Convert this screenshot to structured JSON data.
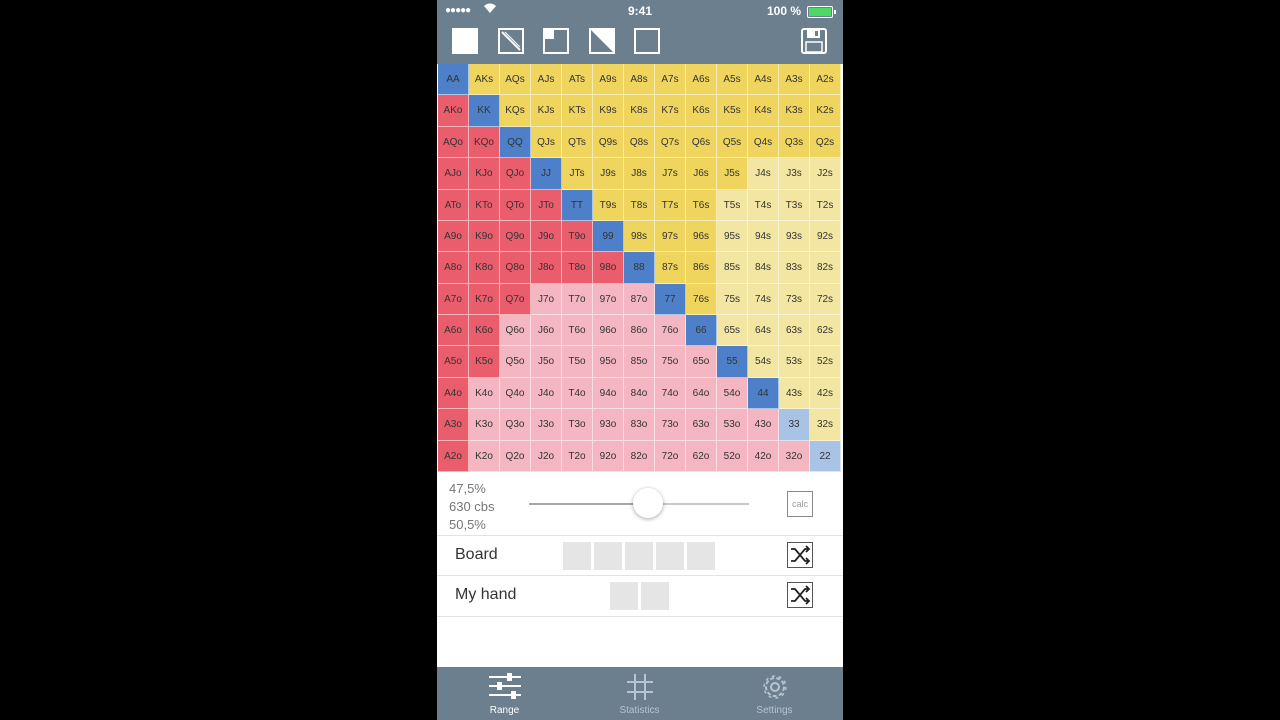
{
  "status_bar": {
    "signal": "●●●●●",
    "time": "9:41",
    "battery": "100 %"
  },
  "colors": {
    "pair": "#4d80c8",
    "pair_light": "#a9c3e6",
    "suited": "#efd45e",
    "suited_light": "#f3e6a2",
    "offsuit": "#ea5d6c",
    "offsuit_light": "#f4b6c0",
    "toolbar": "#6b7f8f"
  },
  "ranks": [
    "A",
    "K",
    "Q",
    "J",
    "T",
    "9",
    "8",
    "7",
    "6",
    "5",
    "4",
    "3",
    "2"
  ],
  "range": {
    "selected_pairs": [
      "AA",
      "KK",
      "QQ",
      "JJ",
      "TT",
      "99",
      "88",
      "77",
      "66",
      "55",
      "44"
    ],
    "selected_offsuit": [
      "AKo",
      "AQo",
      "AJo",
      "ATo",
      "A9o",
      "A8o",
      "A7o",
      "A6o",
      "A5o",
      "A4o",
      "A3o",
      "A2o",
      "KQo",
      "KJo",
      "KTo",
      "K9o",
      "K8o",
      "K7o",
      "K6o",
      "K5o",
      "QJo",
      "QTo",
      "Q9o",
      "Q8o",
      "Q7o",
      "JTo",
      "J9o",
      "J8o",
      "T9o",
      "T8o",
      "98o"
    ],
    "selected_suited": [
      "AKs",
      "AQs",
      "AJs",
      "ATs",
      "A9s",
      "A8s",
      "A7s",
      "A6s",
      "A5s",
      "A4s",
      "A3s",
      "A2s",
      "KQs",
      "KJs",
      "KTs",
      "K9s",
      "K8s",
      "K7s",
      "K6s",
      "K5s",
      "K4s",
      "K3s",
      "K2s",
      "QJs",
      "QTs",
      "Q9s",
      "Q8s",
      "Q7s",
      "Q6s",
      "Q5s",
      "Q4s",
      "Q3s",
      "Q2s",
      "JTs",
      "J9s",
      "J8s",
      "J7s",
      "J6s",
      "J5s",
      "T9s",
      "T8s",
      "T7s",
      "T6s",
      "98s",
      "97s",
      "96s",
      "87s",
      "86s",
      "76s"
    ]
  },
  "stats": {
    "line1": "47,5%",
    "line2": "630 cbs",
    "line3": "50,5%"
  },
  "slider": {
    "value": 0.54
  },
  "calc_label": "calc",
  "board": {
    "label": "Board",
    "slots": 5
  },
  "my_hand": {
    "label": "My hand",
    "slots": 2
  },
  "tabs": [
    {
      "label": "Range"
    },
    {
      "label": "Statistics"
    },
    {
      "label": "Settings"
    }
  ]
}
